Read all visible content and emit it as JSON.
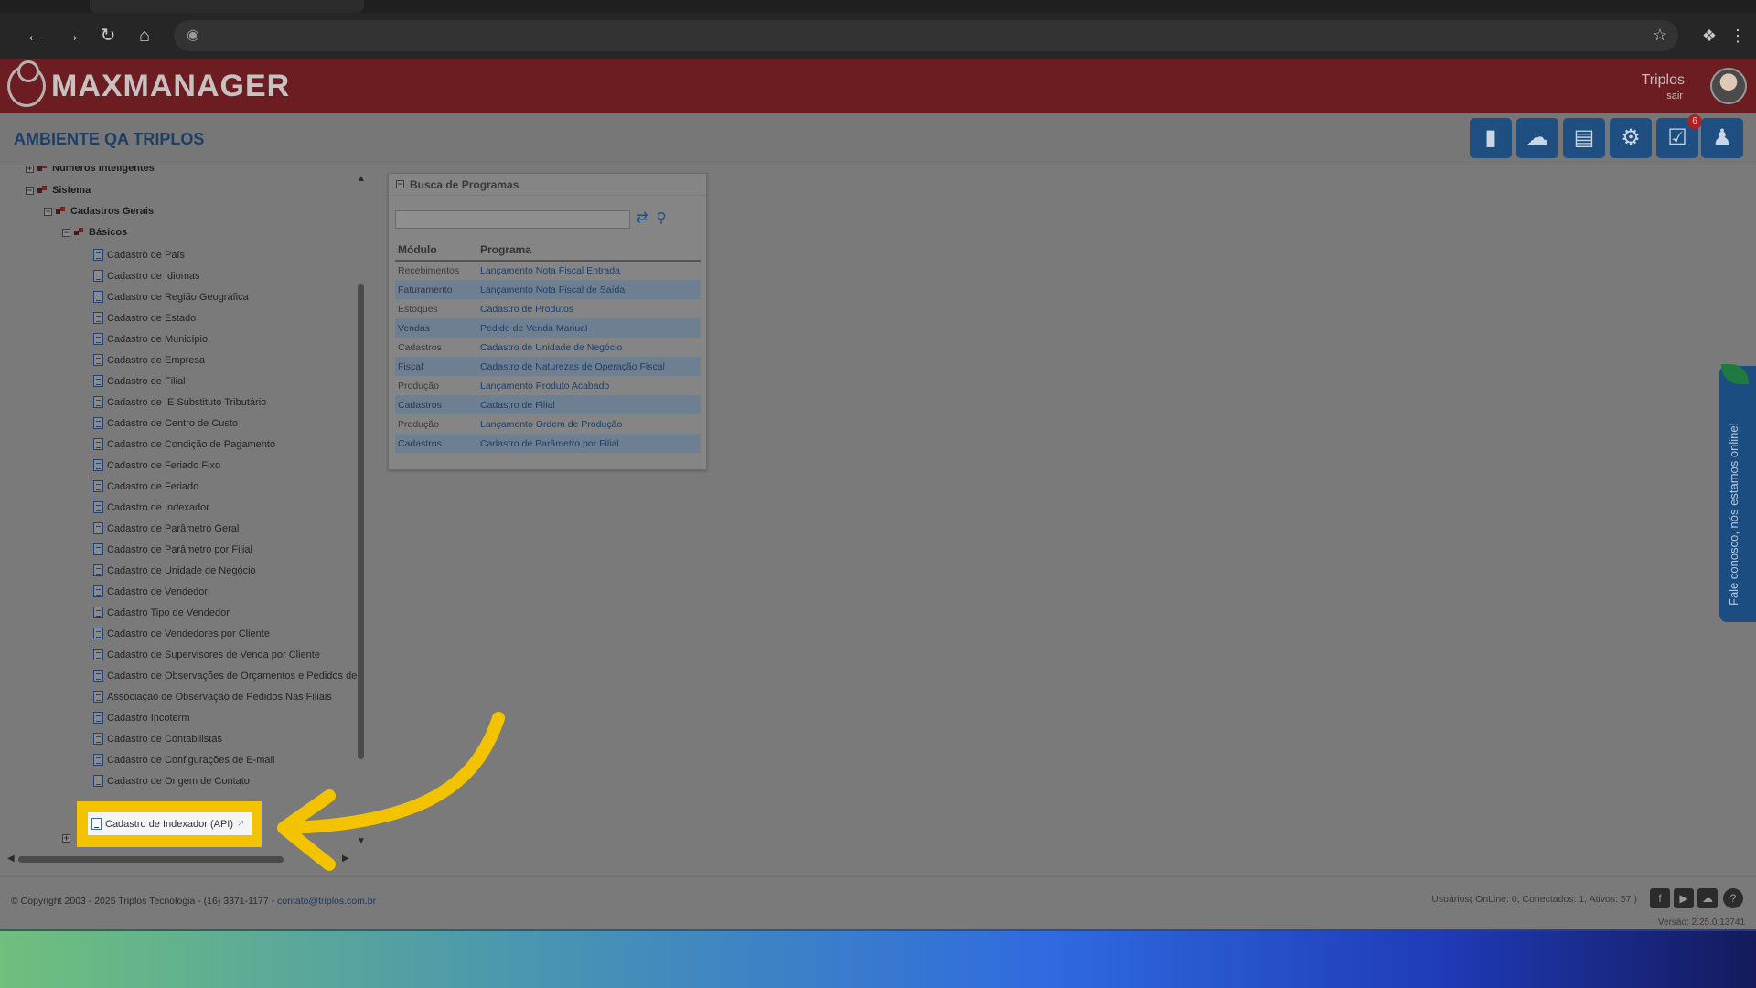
{
  "browser": {
    "nav_icons": [
      "back-icon",
      "forward-icon",
      "reload-icon",
      "home-icon"
    ],
    "address_text": "",
    "right_icons": [
      "bookmark-star-icon",
      "extensions-icon",
      "menu-dots-icon"
    ]
  },
  "header": {
    "brand": "MAXMANAGER",
    "user_name": "Triplos",
    "logout_label": "sair"
  },
  "env": {
    "title": "AMBIENTE QA TRIPLOS",
    "toolbar_icons": [
      "reports-icon",
      "api-icon",
      "documents-icon",
      "settings-icon",
      "tasks-icon",
      "support-agent-icon"
    ],
    "tasks_badge": "6"
  },
  "tree": {
    "top_folder": "Números Inteligentes",
    "sistema": "Sistema",
    "cadastros_gerais": "Cadastros Gerais",
    "basicos": "Básicos",
    "items": [
      "Cadastro de País",
      "Cadastro de Idiomas",
      "Cadastro de Região Geográfica",
      "Cadastro de Estado",
      "Cadastro de Município",
      "Cadastro de Empresa",
      "Cadastro de Filial",
      "Cadastro de IE Substituto Tributário",
      "Cadastro de Centro de Custo",
      "Cadastro de Condição de Pagamento",
      "Cadastro de Feriado Fixo",
      "Cadastro de Feriado",
      "Cadastro de Indexador",
      "Cadastro de Parâmetro Geral",
      "Cadastro de Parâmetro por Filial",
      "Cadastro de Unidade de Negócio",
      "Cadastro de Vendedor",
      "Cadastro Tipo de Vendedor",
      "Cadastro de Vendedores por Cliente",
      "Cadastro de Supervisores de Venda por Cliente",
      "Cadastro de Observações de Orçamentos e Pedidos de",
      "Associação de Observação de Pedidos Nas Filiais",
      "Cadastro Incoterm",
      "Cadastro de Contabilistas",
      "Cadastro de Configurações de E-mail",
      "Cadastro de Origem de Contato"
    ],
    "highlighted_item": "Cadastro de Indexador (API)"
  },
  "busca": {
    "title": "Busca de Programas",
    "search_value": "",
    "col_modulo": "Módulo",
    "col_programa": "Programa",
    "rows": [
      {
        "modulo": "Recebimentos",
        "programa": "Lançamento Nota Fiscal Entrada"
      },
      {
        "modulo": "Faturamento",
        "programa": "Lançamento Nota Fiscal de Saída"
      },
      {
        "modulo": "Estoques",
        "programa": "Cadastro de Produtos"
      },
      {
        "modulo": "Vendas",
        "programa": "Pedido de Venda Manual"
      },
      {
        "modulo": "Cadastros",
        "programa": "Cadastro de Unidade de Negócio"
      },
      {
        "modulo": "Fiscal",
        "programa": "Cadastro de Naturezas de Operação Fiscal"
      },
      {
        "modulo": "Produção",
        "programa": "Lançamento Produto Acabado"
      },
      {
        "modulo": "Cadastros",
        "programa": "Cadastro de Filial"
      },
      {
        "modulo": "Produção",
        "programa": "Lançamento Ordem de Produção"
      },
      {
        "modulo": "Cadastros",
        "programa": "Cadastro de Parâmetro por Filial"
      }
    ]
  },
  "chat": {
    "label": "Fale conosco, nós estamos online!"
  },
  "footer": {
    "copyright": "© Copyright 2003 - 2025 Triplos Tecnologia - (16) 3371-1177 - ",
    "email": "contato@triplos.com.br",
    "users_info": "Usuários( OnLine: 0, Conectados: 1, Ativos: 57 )",
    "social_icons": [
      "facebook-icon",
      "youtube-icon",
      "cloud-icon",
      "help-icon"
    ],
    "version": "Versão:  2.25.0.13741"
  },
  "colors": {
    "header_bg": "#6b1d22",
    "accent_blue": "#1f4e80",
    "highlight": "#f3c300"
  }
}
